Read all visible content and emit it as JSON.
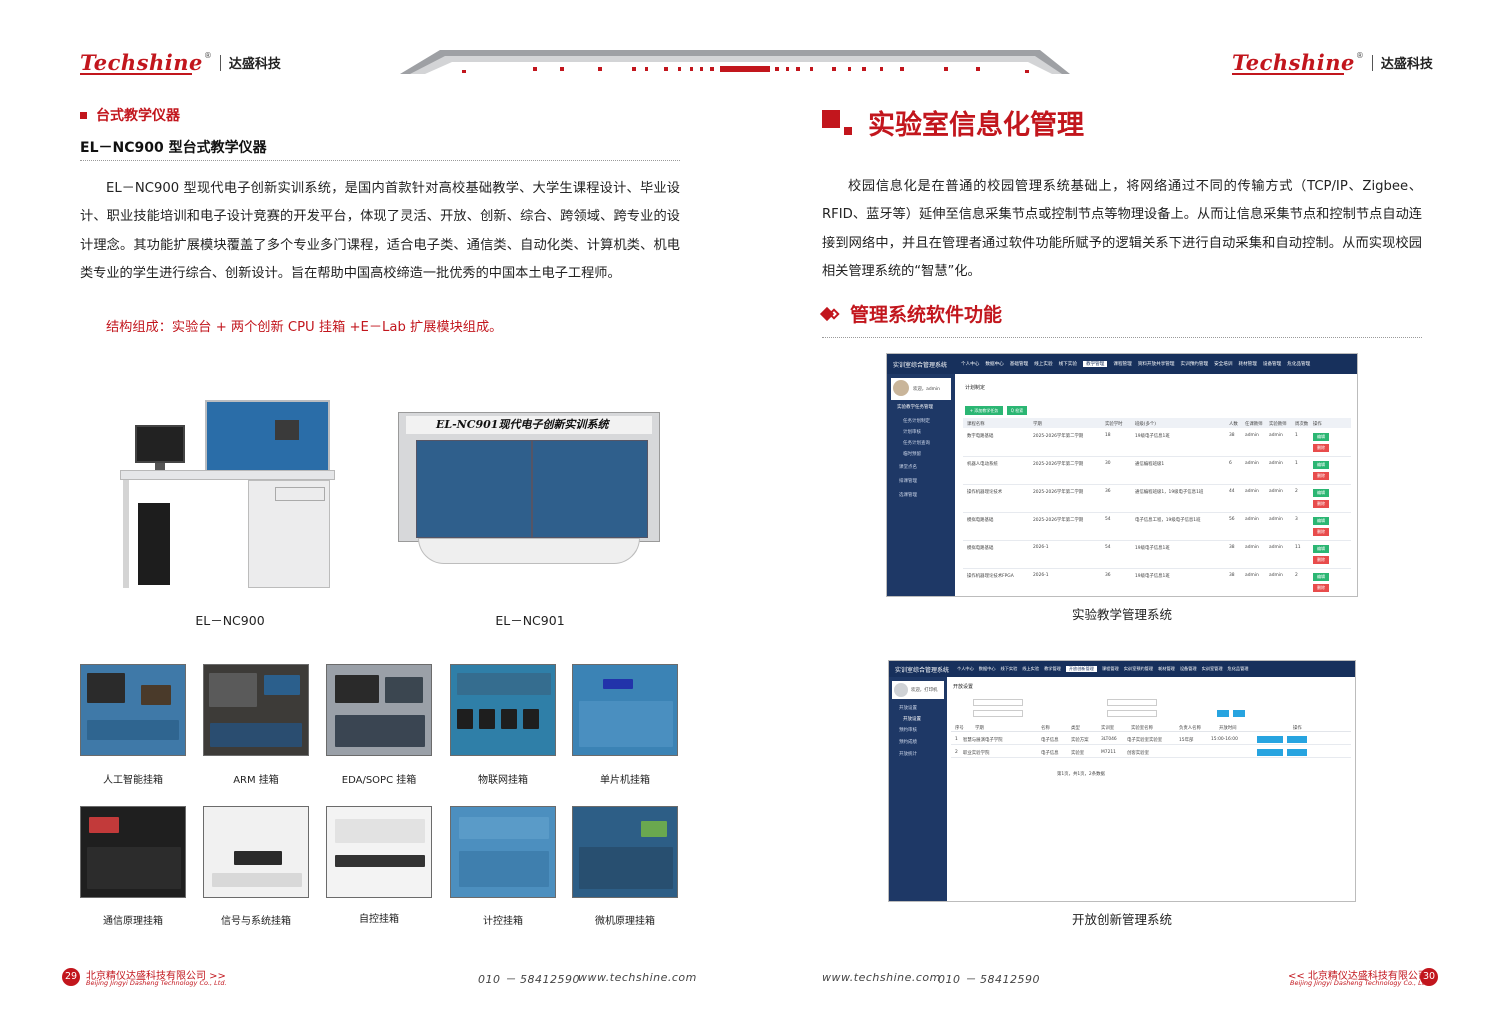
{
  "header": {
    "logo_mark": "Techshine",
    "logo_reg": "®",
    "logo_cn": "达盛科技"
  },
  "left": {
    "section_tag": "台式教学仪器",
    "product_title": "EL－NC900 型台式教学仪器",
    "paragraph": "EL－NC900 型现代电子创新实训系统，是国内首款针对高校基础教学、大学生课程设计、毕业设计、职业技能培训和电子设计竞赛的开发平台，体现了灵活、开放、创新、综合、跨领域、跨专业的设计理念。其功能扩展模块覆盖了多个专业多门课程，适合电子类、通信类、自动化类、计算机类、机电类专业的学生进行综合、创新设计。旨在帮助中国高校缔造一批优秀的中国本土电子工程师。",
    "structure": "结构组成：实验台 + 两个创新 CPU 挂箱 +E－Lab 扩展模块组成。",
    "products": [
      {
        "caption": "EL－NC900"
      },
      {
        "caption": "EL－NC901",
        "banner": "EL-NC901现代电子创新实训系统"
      }
    ],
    "modules_row1": [
      "人工智能挂箱",
      "ARM 挂箱",
      "EDA/SOPC 挂箱",
      "物联网挂箱",
      "单片机挂箱"
    ],
    "modules_row2": [
      "通信原理挂箱",
      "信号与系统挂箱",
      "自控挂箱",
      "计控挂箱",
      "微机原理挂箱"
    ]
  },
  "right": {
    "title": "实验室信息化管理",
    "paragraph": "校园信息化是在普通的校园管理系统基础上，将网络通过不同的传输方式（TCP/IP、Zigbee、RFID、蓝牙等）延伸至信息采集节点或控制节点等物理设备上。从而让信息采集节点和控制节点自动连接到网络中，并且在管理者通过软件功能所赋予的逻辑关系下进行自动采集和自动控制。从而实现校园相关管理系统的“智慧”化。",
    "subtitle": "管理系统软件功能",
    "shot1": {
      "caption": "实验教学管理系统",
      "app_title": "实训室综合管理系统",
      "nav": [
        "个人中心",
        "数据中心",
        "基础管理",
        "线上实验",
        "线下实验",
        "教学管理",
        "课程管理",
        "资料开放共享管理",
        "实训预约管理",
        "安全培训",
        "耗材管理",
        "设备管理",
        "危化品管理"
      ],
      "active_nav": "教学管理",
      "user": "欢迎，admin",
      "side": [
        "实验教学任务管理",
        "任务计划制定",
        "计划审核",
        "任务计划查询",
        "临时预留",
        "课堂点名",
        "排课管理",
        "选课管理"
      ],
      "breadcrumb_title": "计划制定",
      "add_button": "+ 添加教学任务",
      "search_button": "Q 检索",
      "headers": [
        "课程名称",
        "学期",
        "实验学时",
        "班级(多个)",
        "人数",
        "任课教师",
        "实验教师",
        "周次数",
        "操作"
      ],
      "rows": [
        [
          "数字电路基础",
          "2025-2026学年第二学期",
          "18",
          "19级电子信息1班",
          "38",
          "admin",
          "admin",
          "1"
        ],
        [
          "机器人电动系统",
          "2025-2026学年第二学期",
          "30",
          "通信编程班级1",
          "6",
          "admin",
          "admin",
          "1"
        ],
        [
          "操作机器理论技术",
          "2025-2026学年第二学期",
          "36",
          "通信编程班级1，19级电子信息1班",
          "44",
          "admin",
          "admin",
          "2"
        ],
        [
          "模拟电路基础",
          "2025-2026学年第二学期",
          "54",
          "电子信息工程，19级电子信息1班",
          "56",
          "admin",
          "admin",
          "3"
        ],
        [
          "模拟电路基础",
          "2026-1",
          "54",
          "19级电子信息1班",
          "38",
          "admin",
          "admin",
          "11"
        ],
        [
          "操作机器理论技术FPGA",
          "2026-1",
          "36",
          "19级电子信息1班",
          "38",
          "admin",
          "admin",
          "2"
        ]
      ],
      "edit_label": "编辑",
      "delete_label": "删除"
    },
    "shot2": {
      "caption": "开放创新管理系统",
      "app_title": "实训室综合管理系统",
      "nav": [
        "个人中心",
        "数据中心",
        "线下实验",
        "线上实验",
        "教学管理",
        "开放创新管理",
        "课程管理",
        "实训室预约管理",
        "耗材管理",
        "设备管理",
        "实训室管理",
        "危化品管理"
      ],
      "active_nav": "开放创新管理",
      "user": "欢迎，打印机",
      "side": [
        "开放设置",
        "开放设置",
        "预约审核",
        "预约成绩",
        "开放统计"
      ],
      "breadcrumb_title": "开放设置",
      "headers": [
        "序号",
        "学期",
        "名称",
        "类型",
        "实训室",
        "实验室名称",
        "负责人名称",
        "开放时间",
        "操作"
      ],
      "rows": [
        [
          "1",
          "智慧与展演电子学院",
          "电子信息",
          "实验方案",
          "3LT046",
          "电子实验室实验室",
          "15年部",
          "15:00-16:00"
        ],
        [
          "2",
          "职业实验学院",
          "电子信息",
          "实验室",
          "M7211",
          "创客实验室",
          "",
          ""
        ]
      ],
      "summary": "第1页，共1页，2条数据"
    }
  },
  "footer": {
    "left_page_num": "29",
    "right_page_num": "30",
    "company_cn_left": "北京精仪达盛科技有限公司 >>",
    "company_cn_right": "<< 北京精仪达盛科技有限公司",
    "company_en": "Beijing Jingyi Dasheng Technology Co., Ltd.",
    "phone": "010 － 58412590",
    "web": "www.techshine.com"
  },
  "colors": {
    "brand_red": "#c2161d",
    "admin_navy": "#17305c"
  }
}
